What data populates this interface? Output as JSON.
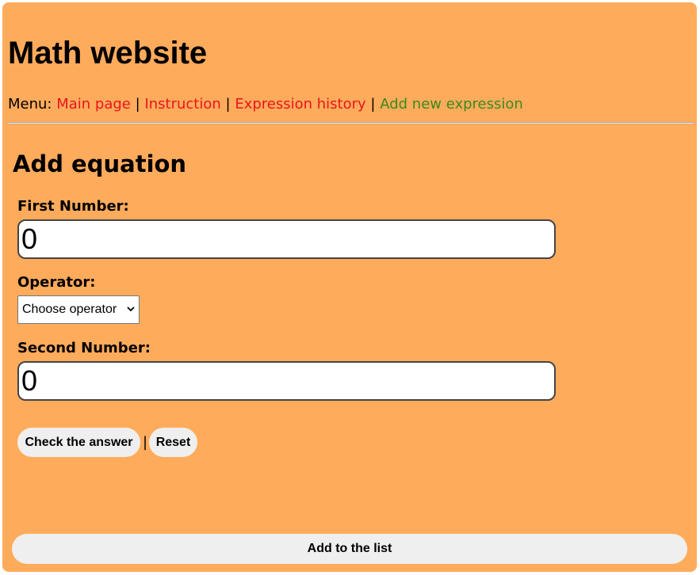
{
  "header": {
    "title": "Math website"
  },
  "menu": {
    "prefix": "Menu:",
    "separator": "|",
    "items": [
      {
        "label": "Main page",
        "state": "link"
      },
      {
        "label": "Instruction",
        "state": "link"
      },
      {
        "label": "Expression history",
        "state": "link"
      },
      {
        "label": "Add new expression",
        "state": "active"
      }
    ]
  },
  "form": {
    "title": "Add equation",
    "first_number": {
      "label": "First Number:",
      "value": "0"
    },
    "operator": {
      "label": "Operator:",
      "selected": "Choose operator"
    },
    "second_number": {
      "label": "Second Number:",
      "value": "0"
    },
    "check_label": "Check the answer",
    "button_separator": "|",
    "reset_label": "Reset",
    "add_label": "Add to the list"
  },
  "colors": {
    "background": "#ffab5c",
    "link": "#e8161b",
    "active_link": "#3a8a1a",
    "button": "#efefef"
  },
  "icons": {
    "select_arrow": "chevron-down-icon"
  }
}
